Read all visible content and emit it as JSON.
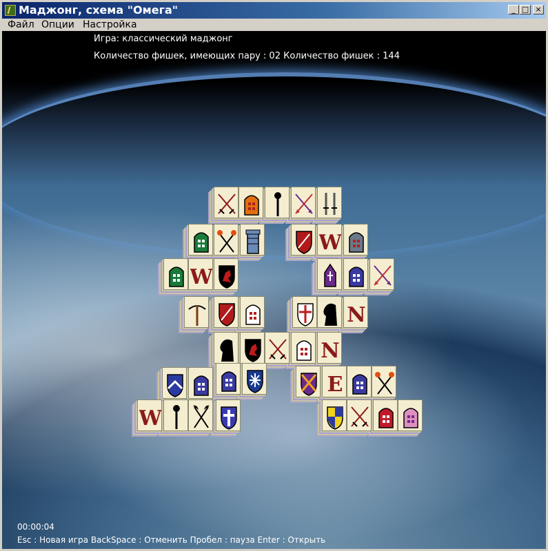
{
  "window": {
    "title": "Маджонг, схема \"Омега\"",
    "minimize_icon": "minimize-icon",
    "maximize_icon": "maximize-icon",
    "close_icon": "close-icon"
  },
  "menu": {
    "items": [
      "Файл",
      "Опции",
      "Настройка"
    ]
  },
  "info": {
    "game_line": "Игра: классический маджонг",
    "pairs_line": "Количество фишек, имеющих пару : 02   Количество фишек : 144"
  },
  "tiles": [
    {
      "symbol": "crossed-swords"
    },
    {
      "symbol": "window-orange"
    },
    {
      "symbol": "mace"
    },
    {
      "symbol": "crossed-arrows"
    },
    {
      "symbol": "sword"
    },
    {
      "symbol": "window-green"
    },
    {
      "symbol": "crossed-torches"
    },
    {
      "symbol": "tower"
    },
    {
      "symbol": "shield-red"
    },
    {
      "symbol": "letter-w"
    },
    {
      "symbol": "window-gray"
    },
    {
      "symbol": "window-green"
    },
    {
      "symbol": "letter-w"
    },
    {
      "symbol": "shield-lion"
    },
    {
      "symbol": "mitre"
    },
    {
      "symbol": "window-blue"
    },
    {
      "symbol": "crossed-arrows"
    },
    {
      "symbol": "crossbow"
    },
    {
      "symbol": "shield-red"
    },
    {
      "symbol": "window-white"
    },
    {
      "symbol": "shield-cross"
    },
    {
      "symbol": "knight"
    },
    {
      "symbol": "letter-n"
    },
    {
      "symbol": "knight"
    },
    {
      "symbol": "shield-lion"
    },
    {
      "symbol": "crossed-swords"
    },
    {
      "symbol": "window-white"
    },
    {
      "symbol": "letter-n"
    },
    {
      "symbol": "shield-chevron"
    },
    {
      "symbol": "window-blue"
    },
    {
      "symbol": "window-blue"
    },
    {
      "symbol": "shield-snow"
    },
    {
      "symbol": "shield-saltire"
    },
    {
      "symbol": "letter-e"
    },
    {
      "symbol": "window-blue"
    },
    {
      "symbol": "crossed-torches"
    },
    {
      "symbol": "letter-w"
    },
    {
      "symbol": "mace"
    },
    {
      "symbol": "crossed-axes"
    },
    {
      "symbol": "shield-cross-blue"
    },
    {
      "symbol": "shield-quarter"
    },
    {
      "symbol": "crossed-swords"
    },
    {
      "symbol": "window-red"
    },
    {
      "symbol": "window-pink"
    }
  ],
  "footer": {
    "timer": "00:00:04",
    "hints": "Esc : Новая игра      BackSpace : Отменить  Пробел : пауза     Enter : Открыть"
  }
}
